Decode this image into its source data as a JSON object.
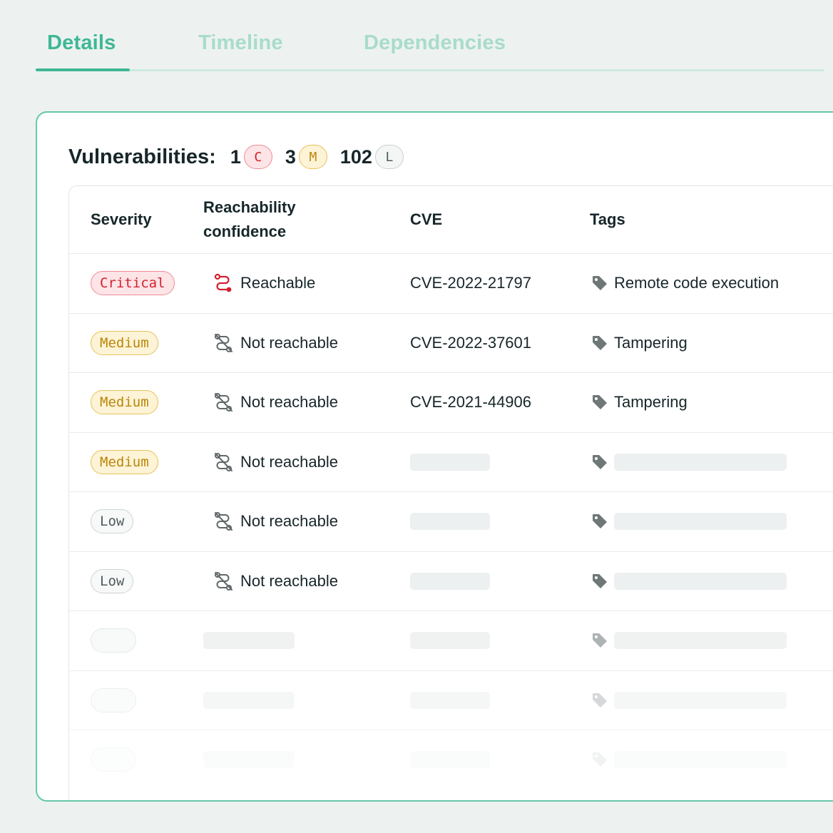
{
  "tabs": [
    {
      "label": "Details",
      "active": true
    },
    {
      "label": "Timeline",
      "active": false
    },
    {
      "label": "Dependencies",
      "active": false
    }
  ],
  "vulnerabilities": {
    "title": "Vulnerabilities:",
    "critical_count": "1",
    "critical_badge": "C",
    "medium_count": "3",
    "medium_badge": "M",
    "low_count": "102",
    "low_badge": "L"
  },
  "table": {
    "headers": {
      "severity": "Severity",
      "reachability_line1": "Reachability",
      "reachability_line2": "confidence",
      "cve": "CVE",
      "tags": "Tags"
    },
    "rows": [
      {
        "severity": "Critical",
        "reachability": "Reachable",
        "cve": "CVE-2022-21797",
        "tag": "Remote code execution"
      },
      {
        "severity": "Medium",
        "reachability": "Not reachable",
        "cve": "CVE-2022-37601",
        "tag": "Tampering"
      },
      {
        "severity": "Medium",
        "reachability": "Not reachable",
        "cve": "CVE-2021-44906",
        "tag": "Tampering"
      },
      {
        "severity": "Medium",
        "reachability": "Not reachable"
      },
      {
        "severity": "Low",
        "reachability": "Not reachable"
      },
      {
        "severity": "Low",
        "reachability": "Not reachable"
      }
    ]
  },
  "icons": {
    "reachable": "route-icon",
    "not_reachable": "route-off-icon",
    "tag": "tag-icon"
  },
  "colors": {
    "accent": "#3fb794",
    "critical": "#d4202f",
    "medium": "#b9860a",
    "low": "#4f5b5d"
  }
}
